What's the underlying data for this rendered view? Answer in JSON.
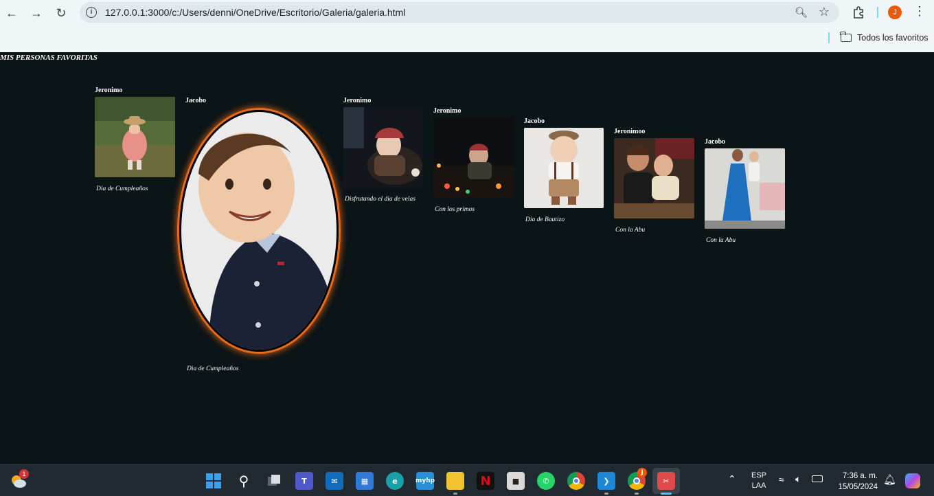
{
  "browser": {
    "url": "127.0.0.1:3000/c:/Users/denni/OneDrive/Escritorio/Galeria/galeria.html",
    "profile_initial": "J",
    "bookmark_folder": "Todos los favoritos"
  },
  "page": {
    "title": "MIS PERSONAS FAVORITAS",
    "cards": [
      {
        "name": "Jeronimo",
        "caption": "Dia de Cumpleaños"
      },
      {
        "name": "Jacobo",
        "caption": "Dia de Cumpleaños"
      },
      {
        "name": "Jeronimo",
        "caption": "Disfrutando el dia de velas"
      },
      {
        "name": "Jeronimo",
        "caption": "Con los primos"
      },
      {
        "name": "Jacobo",
        "caption": "Dia de Bautizo"
      },
      {
        "name": "Jeronimoo",
        "caption": "Con la Abu"
      },
      {
        "name": "Jacobo",
        "caption": "Con la Abu"
      }
    ]
  },
  "taskbar": {
    "weather_badge": "1",
    "chrome_badge": "J",
    "language": "ESP",
    "layout": "LAA",
    "time": "7:36 a. m.",
    "date": "15/05/2024",
    "icons": [
      "windows-start",
      "search",
      "task-view",
      "teams",
      "mail",
      "store",
      "edge",
      "myhp",
      "file-explorer",
      "netflix",
      "roblox",
      "whatsapp",
      "chrome",
      "vscode",
      "chrome-profile",
      "snipping-tool"
    ]
  }
}
